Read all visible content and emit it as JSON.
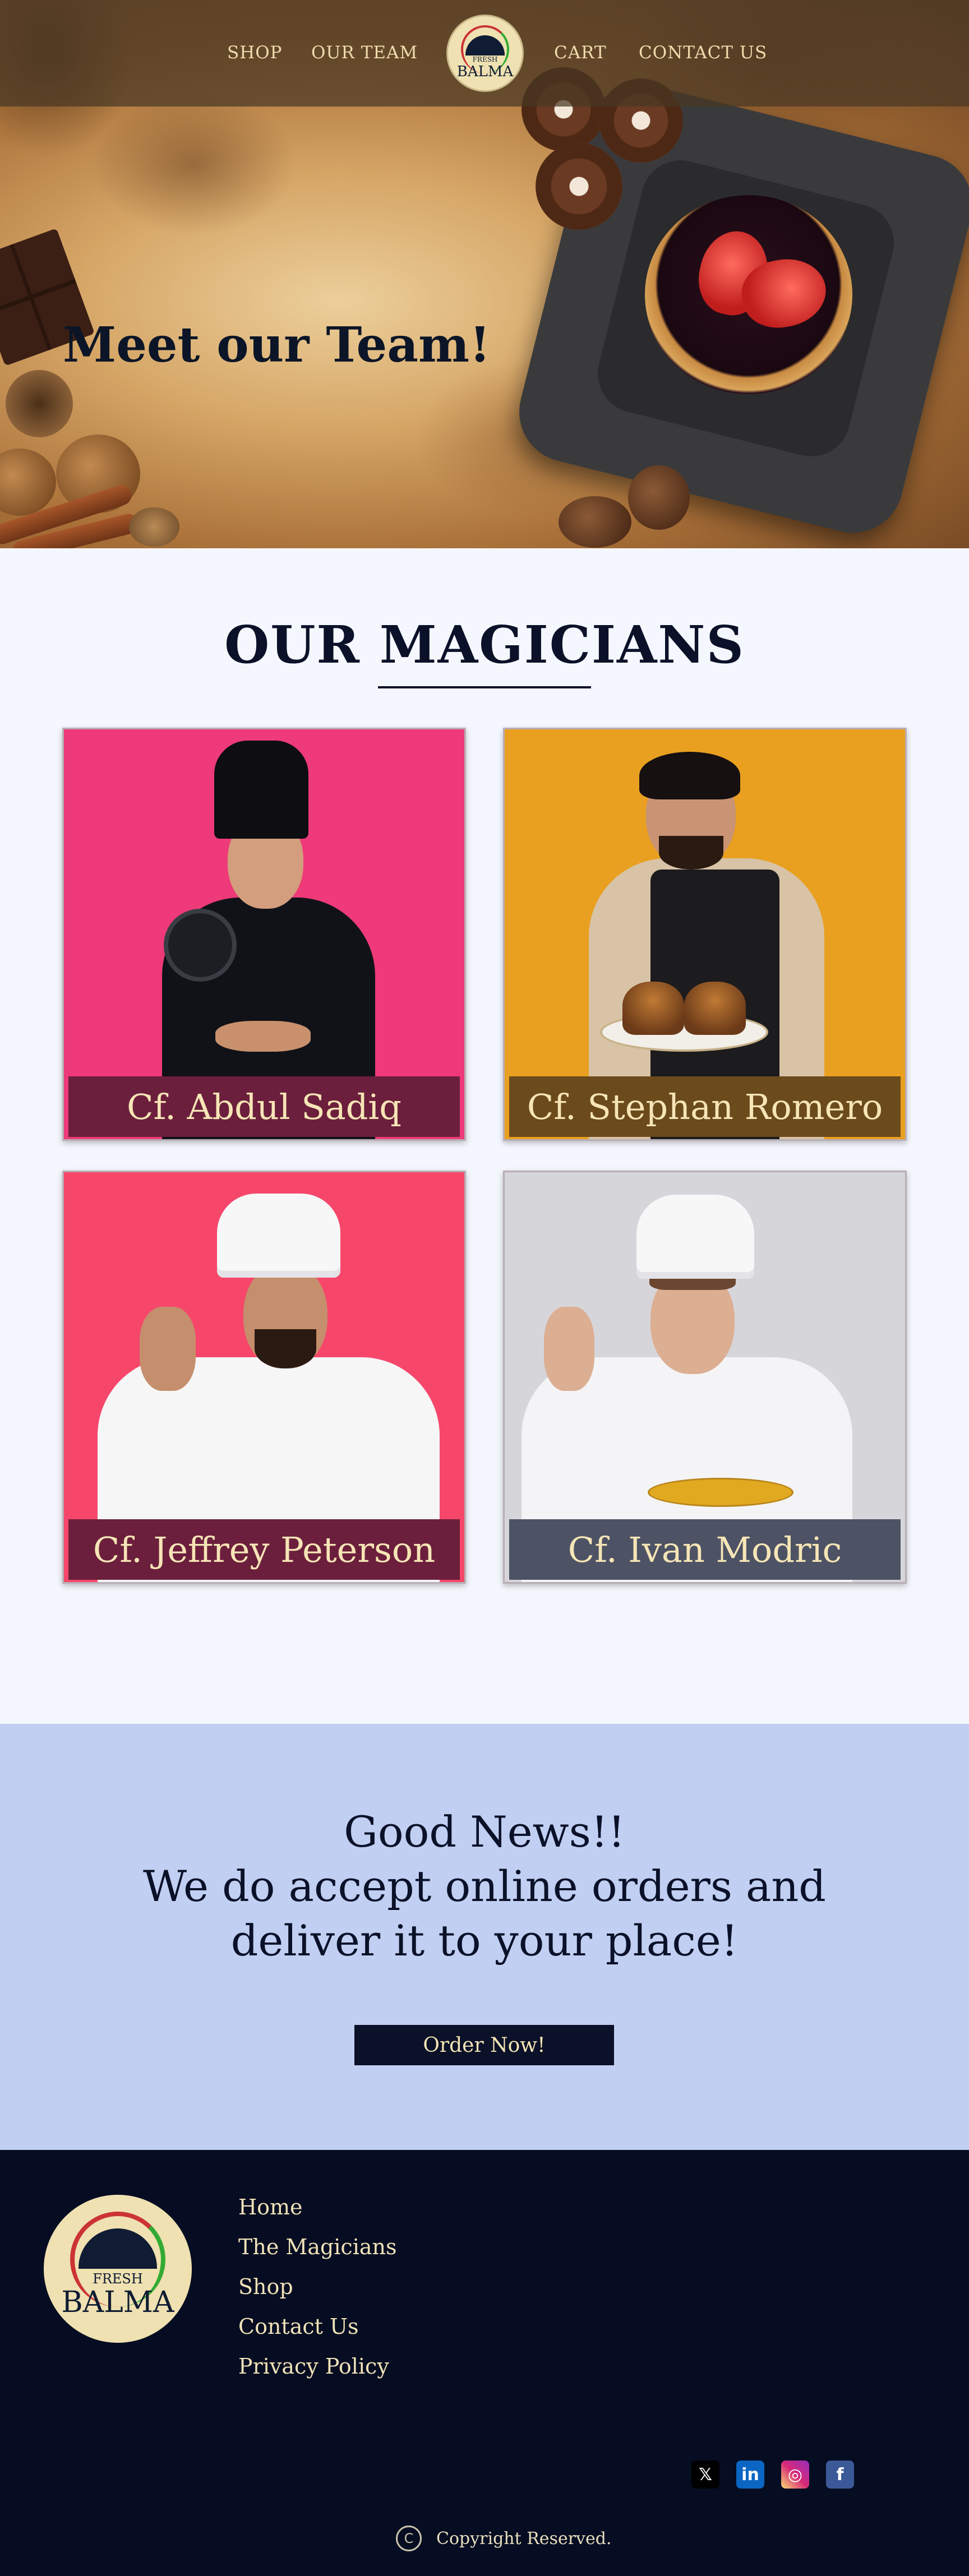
{
  "nav": {
    "left_links": [
      "SHOP",
      "OUR TEAM"
    ],
    "right_links": [
      "CART",
      "CONTACT US"
    ],
    "logo": {
      "top_text": "FRESH",
      "main_text": "BALMA"
    }
  },
  "hero": {
    "title": "Meet our Team!"
  },
  "magicians": {
    "title": "OUR MAGICIANS",
    "chefs": [
      {
        "name": "Cf. Abdul Sadiq",
        "bg": "#ee3a78",
        "band": "#6c1f3c"
      },
      {
        "name": "Cf. Stephan Romero",
        "bg": "#e9a020",
        "band": "#6b4a1c"
      },
      {
        "name": "Cf. Jeffrey Peterson",
        "bg": "#f6476b",
        "band": "#6c1f3c"
      },
      {
        "name": "Cf. Ivan Modric",
        "bg": "#d6d5da",
        "band": "#4d5364"
      }
    ]
  },
  "news": {
    "lines": [
      "Good News!!",
      "We do accept online orders and",
      "deliver it to your place!"
    ],
    "button": "Order Now!"
  },
  "footer": {
    "logo": {
      "top_text": "FRESH",
      "main_text": "BALMA"
    },
    "links": [
      "Home",
      "The Magicians",
      "Shop",
      "Contact Us",
      "Privacy Policy"
    ],
    "social": [
      {
        "icon": "x-icon",
        "glyph": "𝕏",
        "color": "#000000"
      },
      {
        "icon": "linkedin-icon",
        "glyph": "in",
        "color": "#0a66c2"
      },
      {
        "icon": "instagram-icon",
        "glyph": "◎",
        "color": "#d62976"
      },
      {
        "icon": "facebook-icon",
        "glyph": "f",
        "color": "#3b5998"
      }
    ],
    "copyright_symbol": "C",
    "copyright": "Copyright Reserved."
  }
}
